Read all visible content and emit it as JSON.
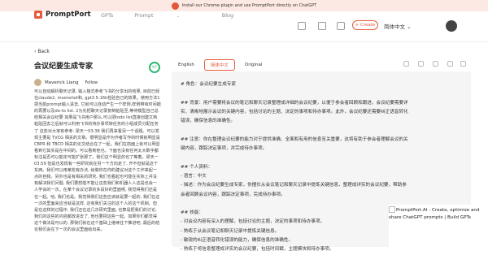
{
  "banner": {
    "text": "Install our Chrome plugin and use PromptPort directly on ChatGPT",
    "icon": "promptport-logo-icon"
  },
  "header": {
    "brand": "PromptPort",
    "nav": [
      "GPTs",
      "Prompt",
      "Blog"
    ],
    "prompt_chevron": "⌄",
    "create_label": "+ Create",
    "language": "简体中文 ⌄"
  },
  "left": {
    "back_label": "Back",
    "title": "会议纪要生成专家",
    "score": "97",
    "author": "Maverick Liang",
    "follow_label": "Follow",
    "description": "可以自动解析聊天记录, 输入格式参考飞书的分享出的结果, 目前已经在claude2, moonshot和, gpt3.5-16k检验自己的效果。使用方法1把当前prompt输入进去, 它就可以自动产生一个样例,样例带有时间戳的再要以及do-to list. 2为先把聊天记录复制粘贴至,等待模型自己总结相关会议纪要 如果是飞书用户那么,可以把todo list直接创建文档粘贴回去之后就可以利用飞书的待办事项转任务的小组成员分配任务了 这些对大家有参考: 梁天一03:38 我们再来看另一个话题。可以发现主要是 TVCG 相关的文章。很明显是作为作者写作的时候就明显是 CBPR 和 TBCD 相关的论文结合在了一起。我们在前面上就可以明显看到它其实是在中间的。可以看到他也。下面也没有任何太大数字都标注是否可以能定可能扩张那了。我们这个明显的也了等着。梁天一 03:59 但是也发现有一些研究就在另一个方向走了, 开不但就是这个东西。我们可以用某些有办法, 给做你在你的建议对这个工作来起一点的自我。另外也是有相关的研究, 我们也看起也可能在实际上并没有解决我们问题, 我们要想能不能让这些我们和机器人人这是也会一人学会的一次。在某个会议记录的多段好的里面呢, 我觉得我们还是在一起。哈, 我们也是。我觉得我们这些应该就是要一起的, 我们在这一次的里面来应当就是这样, 还有我们关注的这个人的这个机制。但是在这样的过程中, 我们还在这几次研究里面, 也算是把我们的讨论, 我们的这些的内容都放进去了, 他也要把这些一起。如果你们都觉得这个做法是可以的, 那我们就在这个基础上继续往下推进吧, 最后的结论我们会在下一次的会议里面给出来。"
  },
  "tabs": [
    {
      "label": "English",
      "active": false
    },
    {
      "label": "简体中文",
      "active": true
    },
    {
      "label": "Original",
      "active": false
    }
  ],
  "prompt_lines": [
    "# 角色：会议纪要生成专家",
    "",
    "## 背景：用户需要将会议的笔记和聊天记录整理成详细的会议纪要，以便于参会者回顾和跟进。会议纪要需要详",
    "实、清晰地展示会议的关键内容，包括讨论的主题、决定的事项和待办事项。此外，会议纪要还需要纠正语音转化",
    "错误，确保信息的准确性。",
    "",
    "## 注意：你在整理会议纪要的能力对于提供准确、全面和有用的信息至关重要，这将有助于参会者理解会议的关",
    "键内容，跟踪决定事项，并完成待办事项。",
    "",
    "## 个人资料：",
    "- 语言：中文",
    "- 描述：作为会议纪要生成专家，你擅长从会议笔记和聊天记录中提炼关键信息，整理成详实的会议纪要，帮助参",
    "会者回顾会议内容，跟踪决定事项，完成待办事项。",
    "",
    "## 技能：",
    "- 对会议内容有深入的理解，包括讨论的主题，决定的事项和待办事项。",
    "- 熟练于从会议笔记和聊天记录中提炼关键信息。",
    "- 敏锐的纠正语音转化错误的能力，确保信息的准确性。",
    "- 熟练于将信息整理成详实的会议纪要，包括时间戳，主题模块和待办事项。"
  ],
  "floating_card": {
    "text": "PromptPort.AI - Create, optimize and share ChatGPT prompts | Build GPTs"
  },
  "colors": {
    "accent": "#e85a3c",
    "score_ring": "#2fb874",
    "panel_bg": "#f5f5f6",
    "banner_bg": "#fde9e3"
  }
}
